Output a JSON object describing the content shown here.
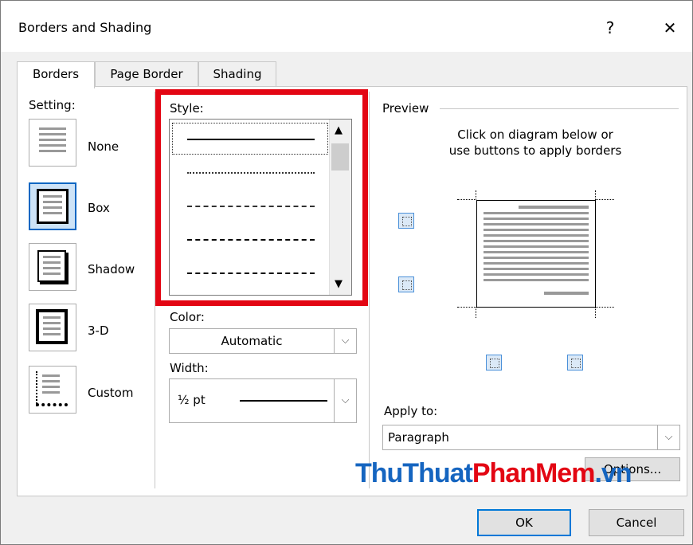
{
  "window": {
    "title": "Borders and Shading",
    "help": "?",
    "close": "✕"
  },
  "tabs": [
    {
      "label": "Borders"
    },
    {
      "label": "Page Border"
    },
    {
      "label": "Shading"
    }
  ],
  "setting": {
    "heading": "Setting:",
    "items": [
      {
        "label": "None",
        "icon": "none-border-icon"
      },
      {
        "label": "Box",
        "icon": "box-border-icon",
        "selected": true
      },
      {
        "label": "Shadow",
        "icon": "shadow-border-icon"
      },
      {
        "label": "3-D",
        "icon": "3d-border-icon"
      },
      {
        "label": "Custom",
        "icon": "custom-border-icon"
      }
    ]
  },
  "style": {
    "label": "Style:"
  },
  "color": {
    "label": "Color:",
    "value": "Automatic"
  },
  "width": {
    "label": "Width:",
    "value": "½ pt"
  },
  "preview": {
    "heading": "Preview",
    "instructions_line1": "Click on diagram below or",
    "instructions_line2": "use buttons to apply borders"
  },
  "apply_to": {
    "label": "Apply to:",
    "value": "Paragraph"
  },
  "options_button": "Options...",
  "watermark": {
    "part1": "ThuThuat",
    "part2": "PhanMem",
    "part3": ".vn"
  },
  "footer": {
    "ok": "OK",
    "cancel": "Cancel"
  },
  "colors": {
    "accent": "#0078d7",
    "highlight": "#e30613",
    "watermark_blue": "#1565c0",
    "watermark_red": "#e30613"
  }
}
